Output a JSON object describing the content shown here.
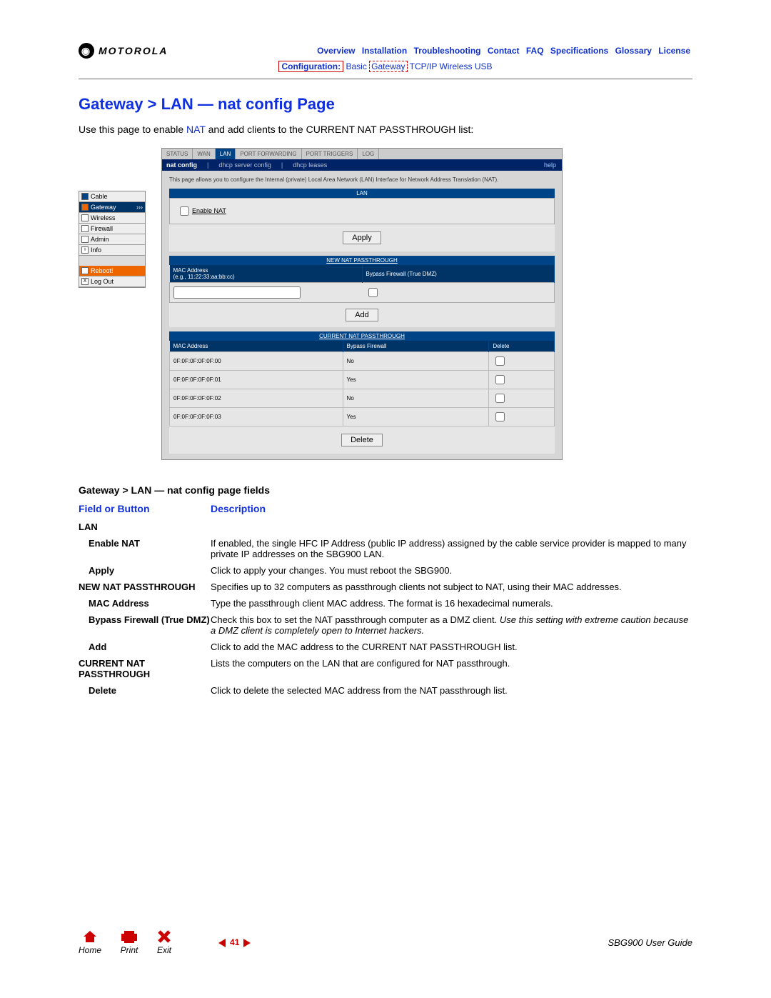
{
  "brand": "MOTOROLA",
  "topnav": [
    "Overview",
    "Installation",
    "Troubleshooting",
    "Contact",
    "FAQ",
    "Specifications",
    "Glossary",
    "License"
  ],
  "subnav": {
    "cfg": "Configuration:",
    "items": [
      "Basic",
      "Gateway",
      "TCP/IP",
      "Wireless",
      "USB"
    ]
  },
  "title": "Gateway > LAN — nat config Page",
  "intro_pre": "Use this page to enable ",
  "intro_link": "NAT",
  "intro_post": " and add clients to the CURRENT NAT PASSTHROUGH list:",
  "sidenav": {
    "items": [
      "Cable",
      "Gateway",
      "Wireless",
      "Firewall",
      "Admin",
      "Info"
    ],
    "reboot": "Reboot!",
    "logout": "Log Out"
  },
  "shot": {
    "tabs": [
      "STATUS",
      "WAN",
      "LAN",
      "PORT FORWARDING",
      "PORT TRIGGERS",
      "LOG"
    ],
    "subtabs": [
      "nat config",
      "dhcp server config",
      "dhcp leases"
    ],
    "help": "help",
    "desc": "This page allows you to configure the Internal (private) Local Area Network (LAN) Interface for Network Address Translation (NAT).",
    "lan_hdr": "LAN",
    "enable": "Enable NAT",
    "apply": "Apply",
    "np_hdr": "NEW NAT PASSTHROUGH",
    "mac_hdr": "MAC Address",
    "mac_hint": "(e.g., 11:22:33:aa:bb:cc)",
    "bypass_hdr": "Bypass Firewall (True DMZ)",
    "add": "Add",
    "cur_hdr": "CURRENT NAT PASSTHROUGH",
    "del_hdr": "Delete",
    "delete": "Delete",
    "rows": [
      {
        "mac": "0F:0F:0F:0F:0F:00",
        "bypass": "No"
      },
      {
        "mac": "0F:0F:0F:0F:0F:01",
        "bypass": "Yes"
      },
      {
        "mac": "0F:0F:0F:0F:0F:02",
        "bypass": "No"
      },
      {
        "mac": "0F:0F:0F:0F:0F:03",
        "bypass": "Yes"
      }
    ]
  },
  "fields_title": "Gateway > LAN — nat config page fields",
  "col1": "Field or Button",
  "col2": "Description",
  "fields": [
    {
      "sec": true,
      "label": "LAN",
      "desc": ""
    },
    {
      "label": "Enable NAT",
      "desc": "If enabled, the single HFC IP Address (public IP address) assigned by the cable service provider is mapped to many private IP addresses on the SBG900 LAN."
    },
    {
      "label": "Apply",
      "desc": "Click to apply your changes. You must reboot the SBG900."
    },
    {
      "sec": true,
      "label": "NEW NAT PASSTHROUGH",
      "desc": "Specifies up to 32 computers as passthrough clients not subject to NAT, using their MAC addresses."
    },
    {
      "label": "MAC Address",
      "desc": "Type the passthrough client MAC address. The format is 16 hexadecimal numerals."
    },
    {
      "label": "Bypass Firewall (True DMZ)",
      "desc": "Check this box to set the NAT passthrough computer as a DMZ client. ",
      "italic": "Use this setting with extreme caution because a DMZ client is completely open to Internet hackers."
    },
    {
      "label": "Add",
      "desc": "Click to add the MAC address to the CURRENT NAT PASSTHROUGH list."
    },
    {
      "sec": true,
      "label": "CURRENT NAT PASSTHROUGH",
      "desc": "Lists the computers on the LAN that are configured for NAT passthrough."
    },
    {
      "label": "Delete",
      "desc": "Click to delete the selected MAC address from the NAT passthrough list."
    }
  ],
  "footer": {
    "home": "Home",
    "print": "Print",
    "exit": "Exit",
    "page": "41",
    "guide": "SBG900 User Guide"
  }
}
